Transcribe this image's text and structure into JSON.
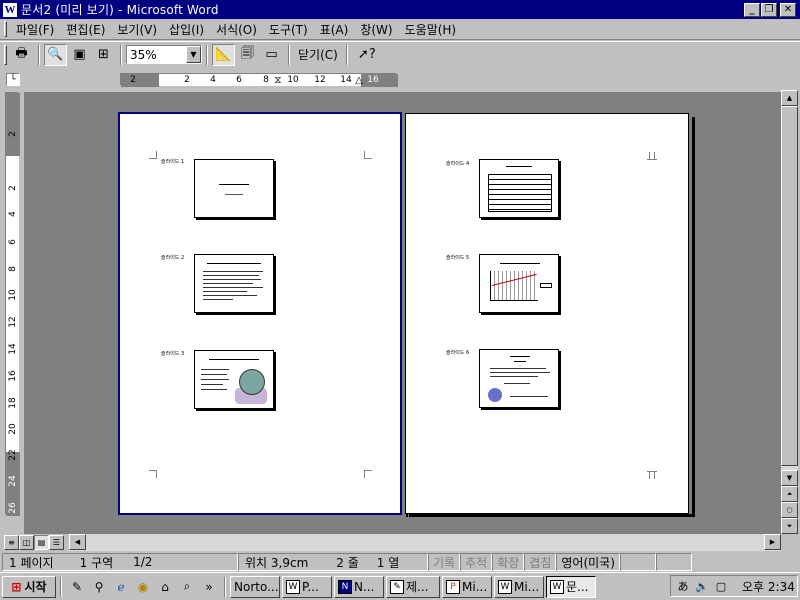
{
  "window": {
    "title": "문서2 (미리 보기) - Microsoft Word",
    "app_icon": "word-document-icon",
    "controls": [
      "minimize-icon",
      "restore-icon",
      "close-icon"
    ]
  },
  "menu": {
    "items": [
      "파일(F)",
      "편집(E)",
      "보기(V)",
      "삽입(I)",
      "서식(O)",
      "도구(T)",
      "표(A)",
      "창(W)",
      "도움말(H)"
    ]
  },
  "toolbar": {
    "zoom_value": "35%",
    "close_label": "닫기(C)",
    "buttons": [
      "print-icon",
      "magnifier-icon",
      "one-page-icon",
      "multiple-pages-icon",
      "view-ruler-icon",
      "shrink-to-fit-icon",
      "full-screen-icon",
      "context-help-icon"
    ]
  },
  "ruler": {
    "horizontal_labels": [
      "2",
      "2",
      "4",
      "6",
      "8",
      "10",
      "12",
      "14",
      "16"
    ],
    "vertical_labels": [
      "2",
      "2",
      "4",
      "6",
      "8",
      "10",
      "12",
      "14",
      "16",
      "18",
      "20",
      "22",
      "24",
      "26"
    ]
  },
  "pages": [
    {
      "slides": [
        {
          "label": "슬라이드 1",
          "kind": "title"
        },
        {
          "label": "슬라이드 2",
          "kind": "bullets"
        },
        {
          "label": "슬라이드 3",
          "kind": "globe"
        }
      ]
    },
    {
      "slides": [
        {
          "label": "슬라이드 4",
          "kind": "table"
        },
        {
          "label": "슬라이드 5",
          "kind": "chart"
        },
        {
          "label": "슬라이드 6",
          "kind": "certificate"
        }
      ]
    }
  ],
  "statusbar": {
    "page": "1 페이지",
    "section": "1 구역",
    "page_of": "1/2",
    "position": "위치 3,9cm",
    "line": "2 줄",
    "column": "1 열",
    "rec": "기록",
    "trk": "추적",
    "ext": "확장",
    "ovr": "겹침",
    "language": "영어(미국)"
  },
  "taskbar": {
    "start_label": "시작",
    "quick_launch": [
      "pen-icon",
      "network-icon",
      "ie-browser-icon",
      "outlook-icon",
      "desktop-icon",
      "search-icon"
    ],
    "more_label": "»",
    "tasks": [
      {
        "icon": "norton-icon",
        "label": "Norto..."
      },
      {
        "icon": "word-doc-icon",
        "label": "P..."
      },
      {
        "icon": "app-icon",
        "label": "N..."
      },
      {
        "icon": "document-icon",
        "label": "제..."
      },
      {
        "icon": "powerpoint-icon",
        "label": "Mi..."
      },
      {
        "icon": "word-doc-icon",
        "label": "Mi..."
      },
      {
        "icon": "word-doc-icon",
        "label": "문..."
      }
    ],
    "tray_icons": [
      "ime-icon",
      "volume-icon",
      "monitor-icon"
    ],
    "clock": "오후 2:34"
  }
}
